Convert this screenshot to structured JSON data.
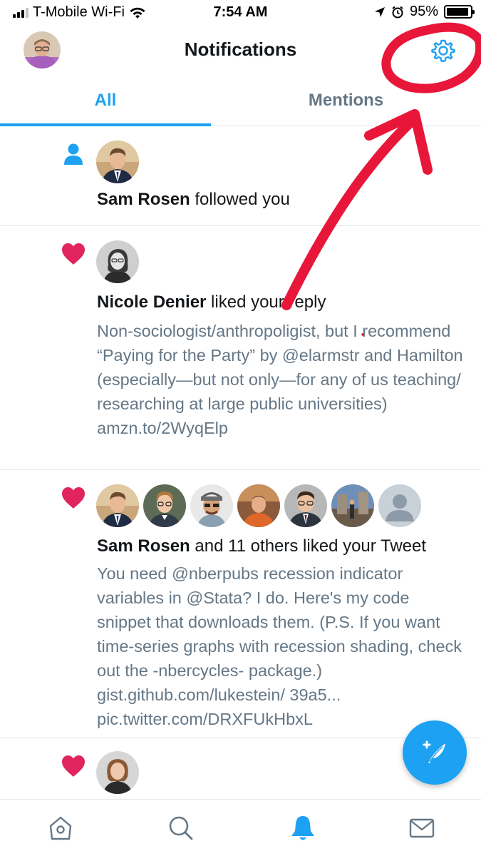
{
  "status_bar": {
    "carrier": "T-Mobile Wi-Fi",
    "time": "7:54 AM",
    "battery_percent": "95%",
    "battery_level": 0.95,
    "signal_bars": 3,
    "signal_max": 4
  },
  "header": {
    "title": "Notifications",
    "profile_avatar": "profile-avatar",
    "settings_icon": "gear-icon"
  },
  "tabs": [
    {
      "label": "All",
      "selected": true
    },
    {
      "label": "Mentions",
      "selected": false
    }
  ],
  "notifications": [
    {
      "type_icon": "person-icon",
      "actor": "Sam Rosen",
      "action": " followed you",
      "preview": ""
    },
    {
      "type_icon": "heart-icon",
      "actor": "Nicole Denier",
      "action": " liked your reply",
      "preview": "Non-sociologist/anthropoligist, but I recommend “Paying for the Party” by @elarmstr and Hamilton (especially—but not only—for any of us teaching/ researching at large public universities) amzn.to/2WyqElp"
    },
    {
      "type_icon": "heart-icon",
      "actor": "Sam Rosen",
      "action": " and 11 others liked your Tweet",
      "preview": "You need @nberpubs recession indicator variables in @Stata? I do. Here's my code snippet that downloads them. (P.S. If you want time-series graphs with recession shading, check out the -nbercycles- package.) gist.github.com/lukestein/ 39a5... pic.twitter.com/DRXFUkHbxL"
    },
    {
      "type_icon": "heart-icon",
      "actor": "",
      "action": "",
      "preview": ""
    }
  ],
  "compose_button": {
    "icon": "compose-feather-icon"
  },
  "tab_bar": [
    {
      "icon": "home-icon",
      "active": false
    },
    {
      "icon": "search-icon",
      "active": false
    },
    {
      "icon": "bell-icon",
      "active": true
    },
    {
      "icon": "mail-icon",
      "active": false
    }
  ],
  "colors": {
    "accent": "#1da1f2",
    "like": "#e0245e",
    "secondary_text": "#657786",
    "primary_text": "#14171a",
    "annotation": "#e8173a"
  }
}
